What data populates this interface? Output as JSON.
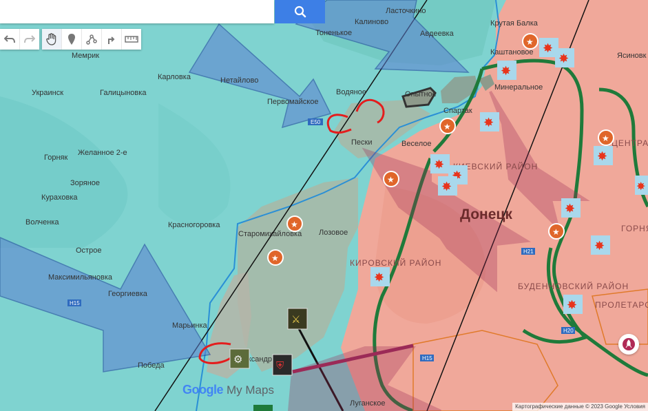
{
  "search": {
    "placeholder": "",
    "value": ""
  },
  "toolbar": {
    "undo": "undo-icon",
    "redo": "redo-icon",
    "hand": "hand-icon",
    "marker": "marker-icon",
    "draw": "draw-line-icon",
    "route": "route-icon",
    "measure": "ruler-icon"
  },
  "places": {
    "lastochkino": "Ласточкино",
    "kalinovo": "Калиново",
    "tonenkoe": "Тоненькое",
    "avdeevka": "Авдеевка",
    "krutaya_balka": "Крутая Балка",
    "kashtanovoe": "Каштановое",
    "yasinovka": "Ясиновк",
    "memrik": "Мемрик",
    "karlovka": "Карловка",
    "netaylovo": "Нетайлово",
    "ukrainsk": "Украинск",
    "galitsynovka": "Галицыновка",
    "pervomayskoe": "Первомайское",
    "vodyanoe": "Водяное",
    "opytnoe": "Опытное",
    "mineralnoe": "Минеральное",
    "spartak": "Спартак",
    "zhelannoe": "Желанное 2-е",
    "peski": "Пески",
    "veseloe": "Веселое",
    "gornyak": "Горняк",
    "zoryanoe": "Зоряное",
    "kurakhovka": "Кураховка",
    "volchenka": "Волченка",
    "krasnogorovka": "Красногоровка",
    "staromikhaylovka": "Старомихайловка",
    "lozovoe": "Лозовое",
    "donetsk": "Донецк",
    "ostroe": "Острое",
    "maksimilyanovka": "Максимильяновка",
    "georgievka": "Георгиевка",
    "marinka": "Марьинка",
    "pobeda": "Победа",
    "aleksandrovka": "Александровка",
    "luganskoe": "Луганское",
    "kirovsky": "КИРОВСКИЙ РАЙОН",
    "budennovsky": "БУДЕННОВСКИЙ РАЙОН",
    "proletarsky": "ПРОЛЕТАРСКИЙ РАЙОН",
    "kievsky": "КИЕВСКИЙ РАЙОН",
    "gorny": "ГОРНЯ",
    "tsentralny": "ЦЕНТРАЛЬНЫЙ",
    "road_e50": "E50",
    "road_h15a": "H15",
    "road_h15b": "H15",
    "road_h21": "H21",
    "road_h20": "H20"
  },
  "legend_colors": {
    "ukraine_control": "#7fd3d0",
    "russia_control": "#f0a89a",
    "grey_zone": "#a9b7a6",
    "ua_attack_arrow": "#5c7fd0",
    "ru_attack_arrow": "#9b2a57",
    "frontline": "#2a8fd6",
    "road_ring": "#1f7a3a",
    "counterattack": "#e41d1d"
  },
  "brand": {
    "google": "Google",
    "product": "My Maps"
  },
  "footer": {
    "attribution": "Картографические данные © 2023 Google   Условия"
  }
}
